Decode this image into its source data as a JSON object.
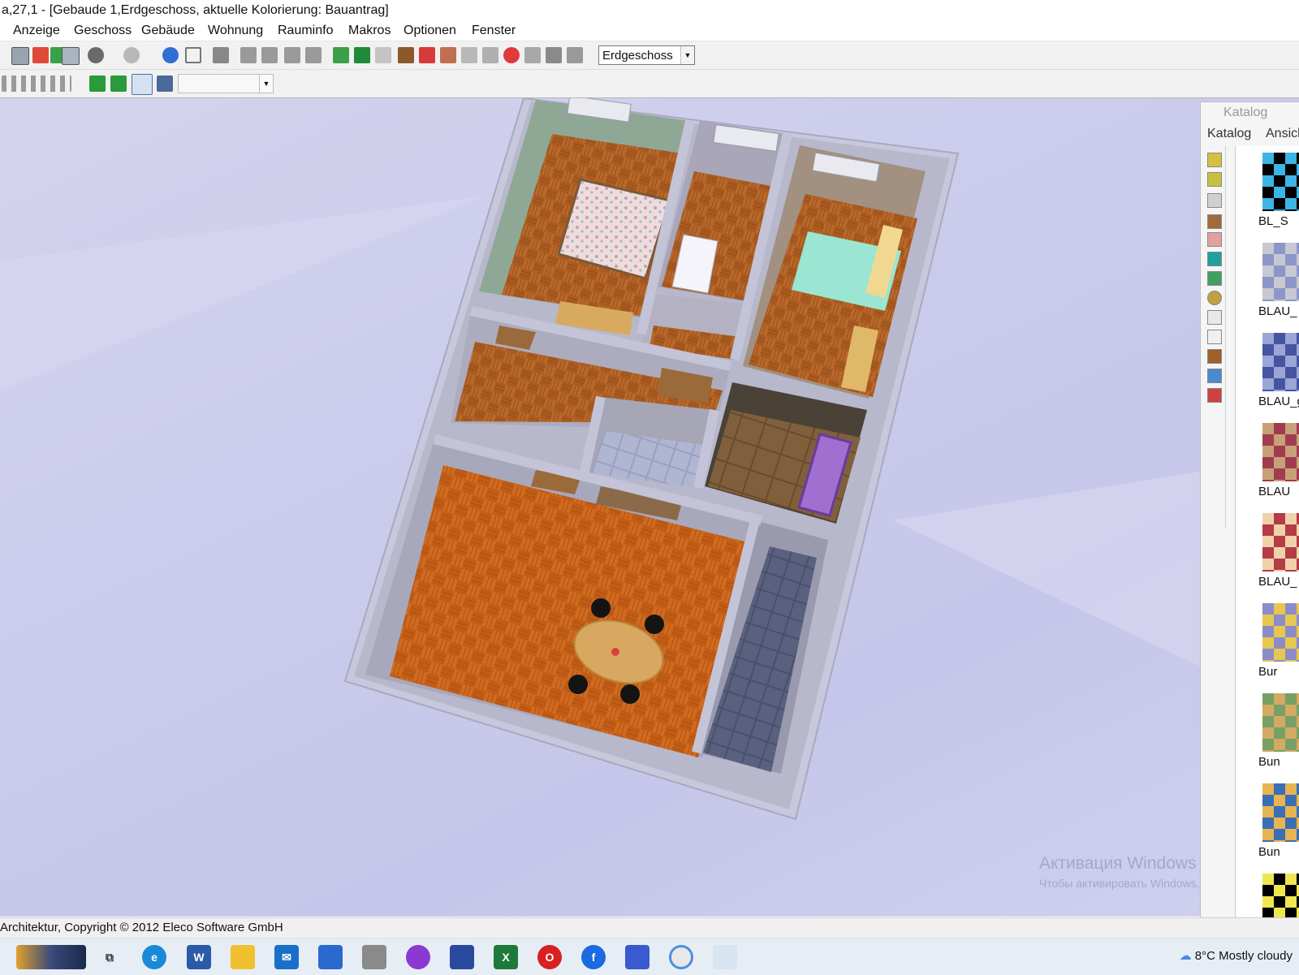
{
  "window": {
    "title": "a,27,1 - [Gebaude 1,Erdgeschoss, aktuelle Kolorierung: Bauantrag]"
  },
  "menu": {
    "items": [
      "Anzeige",
      "Geschoss",
      "Gebäude",
      "Wohnung",
      "Rauminfo",
      "Makros",
      "Optionen",
      "Fenster"
    ]
  },
  "toolbar": {
    "floor_select": "Erdgeschoss",
    "secondary_select": ""
  },
  "catalog": {
    "title": "Katalog",
    "tabs": [
      "Katalog",
      "Ansicl"
    ],
    "items": [
      {
        "label": "BL_S",
        "colors": [
          "#000000",
          "#3cb4e6"
        ]
      },
      {
        "label": "BLAU_",
        "colors": [
          "#8c96c8",
          "#c8c8d2"
        ]
      },
      {
        "label": "BLAU_g",
        "colors": [
          "#4655a0",
          "#9aa5d8"
        ]
      },
      {
        "label": "BLAU",
        "colors": [
          "#a03c50",
          "#c8a078"
        ]
      },
      {
        "label": "BLAU_",
        "colors": [
          "#b43c46",
          "#f0d2aa"
        ]
      },
      {
        "label": "Bur",
        "colors": [
          "#e6c850",
          "#8c8cc8"
        ]
      },
      {
        "label": "Bun",
        "colors": [
          "#d2aa64",
          "#78a064"
        ]
      },
      {
        "label": "Bun",
        "colors": [
          "#3c6eb4",
          "#e6b450"
        ]
      },
      {
        "label": "",
        "colors": [
          "#000000",
          "#f0e650"
        ]
      }
    ]
  },
  "statusbar": {
    "text": "Architektur, Copyright © 2012 Eleco Software GmbH"
  },
  "watermark": {
    "line1": "Активация Windows",
    "line2": "Чтобы активировать Windows, перейдите"
  },
  "taskbar": {
    "weather_temp": "8°C",
    "weather_text": "Mostly cloudy",
    "apps": [
      "task-view",
      "edge",
      "word",
      "explorer",
      "mail",
      "store",
      "calculator",
      "tor",
      "save",
      "excel",
      "opera",
      "facebook",
      "arcon",
      "chrome",
      "paint"
    ]
  }
}
